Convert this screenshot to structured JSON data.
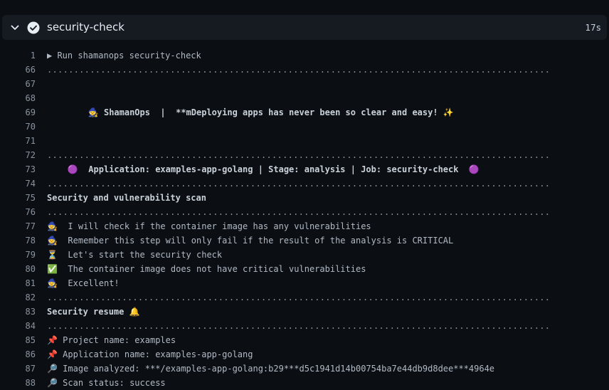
{
  "job": {
    "title": "security-check",
    "duration": "17s",
    "status": "success"
  },
  "icons": {
    "collapse": "chevron-down-icon",
    "status": "check-circle-icon",
    "expand_step": "triangle-right-icon"
  },
  "colors": {
    "background": "#0b0e13",
    "header": "#161b22",
    "text": "#c9d1d9",
    "line_number": "#8b949e"
  },
  "log": {
    "lines": [
      {
        "n": "1",
        "text": "▶ Run shamanops security-check",
        "style": "normal"
      },
      {
        "n": "66",
        "text": "..............................................................................................",
        "style": "dots"
      },
      {
        "n": "67",
        "text": "",
        "style": "normal"
      },
      {
        "n": "68",
        "text": "",
        "style": "normal"
      },
      {
        "n": "69",
        "text": "        🧙 ShamanOps  |  **mDeploying apps has never been so clear and easy! ✨",
        "style": "bold"
      },
      {
        "n": "70",
        "text": "",
        "style": "normal"
      },
      {
        "n": "71",
        "text": "",
        "style": "normal"
      },
      {
        "n": "72",
        "text": "..............................................................................................",
        "style": "dots"
      },
      {
        "n": "73",
        "text": "    🟣  Application: examples-app-golang | Stage: analysis | Job: security-check  🟣",
        "style": "bold"
      },
      {
        "n": "74",
        "text": "..............................................................................................",
        "style": "dots"
      },
      {
        "n": "75",
        "text": "Security and vulnerability scan",
        "style": "bold"
      },
      {
        "n": "76",
        "text": "..............................................................................................",
        "style": "dots"
      },
      {
        "n": "77",
        "text": "🧙  I will check if the container image has any vulnerabilities",
        "style": "normal"
      },
      {
        "n": "78",
        "text": "🧙  Remember this step will only fail if the result of the analysis is CRITICAL",
        "style": "normal"
      },
      {
        "n": "79",
        "text": "⏳  Let's start the security check",
        "style": "normal"
      },
      {
        "n": "80",
        "text": "✅  The container image does not have critical vulnerabilities",
        "style": "normal"
      },
      {
        "n": "81",
        "text": "🧙  Excellent!",
        "style": "normal"
      },
      {
        "n": "82",
        "text": "..............................................................................................",
        "style": "dots"
      },
      {
        "n": "83",
        "text": "Security resume 🔔",
        "style": "bold"
      },
      {
        "n": "84",
        "text": "..............................................................................................",
        "style": "dots"
      },
      {
        "n": "85",
        "text": "📌 Project name: examples",
        "style": "normal"
      },
      {
        "n": "86",
        "text": "📌 Application name: examples-app-golang",
        "style": "normal"
      },
      {
        "n": "87",
        "text": "🔎 Image analyzed: ***/examples-app-golang:b29***d5c1941d14b00754ba7e44db9d8dee***4964e",
        "style": "normal"
      },
      {
        "n": "88",
        "text": "🔎 Scan status: success",
        "style": "normal"
      }
    ]
  }
}
